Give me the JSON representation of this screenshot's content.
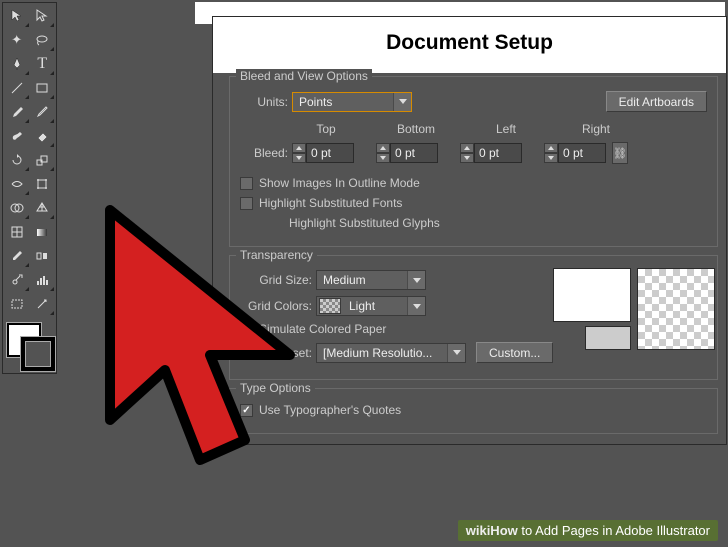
{
  "dialog": {
    "title": "Document Setup",
    "bleed_view": {
      "legend": "Bleed and View Options",
      "units_label": "Units:",
      "units_value": "Points",
      "edit_artboards": "Edit Artboards",
      "bleed_label": "Bleed:",
      "top_label": "Top",
      "top_value": "0 pt",
      "bottom_label": "Bottom",
      "bottom_value": "0 pt",
      "left_label": "Left",
      "left_value": "0 pt",
      "right_label": "Right",
      "right_value": "0 pt",
      "show_images": "Show Images In Outline Mode",
      "highlight_fonts": "Highlight Substituted Fonts",
      "highlight_glyphs": "Highlight Substituted Glyphs"
    },
    "transparency": {
      "legend": "Transparency",
      "grid_size_label": "Grid Size:",
      "grid_size_value": "Medium",
      "grid_colors_label": "Grid Colors:",
      "grid_colors_value": "Light",
      "simulate_paper": "Simulate Colored Paper",
      "preset_label": "Preset:",
      "preset_value": "[Medium Resolutio...",
      "custom": "Custom..."
    },
    "type_options": {
      "legend": "Type Options",
      "typographer_quotes": "Use Typographer's Quotes"
    }
  },
  "watermark": {
    "brand": "wikiHow",
    "article": " to Add Pages in Adobe Illustrator"
  },
  "tools": [
    [
      "selection-tool",
      "direct-selection-tool"
    ],
    [
      "magic-wand-tool",
      "lasso-tool"
    ],
    [
      "pen-tool",
      "type-tool"
    ],
    [
      "line-tool",
      "rectangle-tool"
    ],
    [
      "paintbrush-tool",
      "pencil-tool"
    ],
    [
      "blob-brush-tool",
      "eraser-tool"
    ],
    [
      "rotate-tool",
      "scale-tool"
    ],
    [
      "width-tool",
      "free-transform-tool"
    ],
    [
      "shape-builder-tool",
      "perspective-tool"
    ],
    [
      "mesh-tool",
      "gradient-tool"
    ],
    [
      "eyedropper-tool",
      "blend-tool"
    ],
    [
      "symbol-sprayer-tool",
      "column-graph-tool"
    ],
    [
      "artboard-tool",
      "slice-tool"
    ]
  ]
}
